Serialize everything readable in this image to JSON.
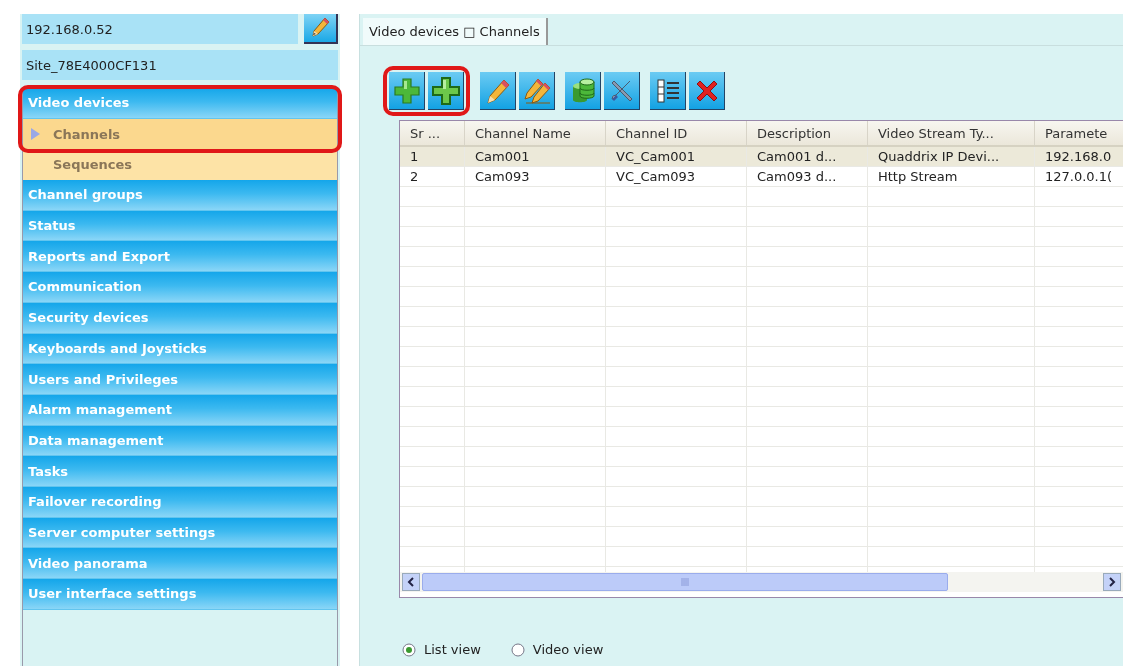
{
  "connection": {
    "address": "192.168.0.52",
    "site": "Site_78E4000CF131"
  },
  "nav": {
    "items": [
      {
        "label": "Video devices",
        "selected": false,
        "highlighted": true,
        "children": [
          {
            "label": "Channels",
            "selected": true,
            "highlighted": true
          },
          {
            "label": "Sequences",
            "selected": false,
            "highlighted": false
          }
        ]
      },
      {
        "label": "Channel groups",
        "selected": false,
        "highlighted": false
      },
      {
        "label": "Status",
        "selected": false,
        "highlighted": false
      },
      {
        "label": "Reports and Export",
        "selected": false,
        "highlighted": false
      },
      {
        "label": "Communication",
        "selected": false,
        "highlighted": false
      },
      {
        "label": "Security devices",
        "selected": false,
        "highlighted": false
      },
      {
        "label": "Keyboards and Joysticks",
        "selected": false,
        "highlighted": false
      },
      {
        "label": "Users and Privileges",
        "selected": false,
        "highlighted": false
      },
      {
        "label": "Alarm management",
        "selected": false,
        "highlighted": false
      },
      {
        "label": "Data management",
        "selected": false,
        "highlighted": false
      },
      {
        "label": "Tasks",
        "selected": false,
        "highlighted": false
      },
      {
        "label": "Failover recording",
        "selected": false,
        "highlighted": false
      },
      {
        "label": "Server computer settings",
        "selected": false,
        "highlighted": false
      },
      {
        "label": "Video panorama",
        "selected": false,
        "highlighted": false
      },
      {
        "label": "User interface settings",
        "selected": false,
        "highlighted": false
      }
    ]
  },
  "tabs": [
    {
      "label": "Video devices □ Channels",
      "selected": true
    }
  ],
  "toolbar": {
    "buttons": [
      {
        "kind": "add",
        "highlighted": true
      },
      {
        "kind": "add-multiple",
        "highlighted": true
      },
      {
        "kind": "edit",
        "highlighted": false
      },
      {
        "kind": "edit-multiple",
        "highlighted": false
      },
      {
        "kind": "database",
        "highlighted": false
      },
      {
        "kind": "tools",
        "highlighted": false
      },
      {
        "kind": "list",
        "highlighted": false
      },
      {
        "kind": "delete",
        "highlighted": false
      }
    ]
  },
  "table": {
    "columns": [
      "Sr ...",
      "Channel Name",
      "Channel ID",
      "Description",
      "Video Stream Ty...",
      "Paramete"
    ],
    "rows": [
      {
        "selected": true,
        "cells": [
          "1",
          "Cam001",
          "VC_Cam001",
          "Cam001 d...",
          "Quaddrix IP Devi...",
          "192.168.0"
        ]
      },
      {
        "selected": false,
        "cells": [
          "2",
          "Cam093",
          "VC_Cam093",
          "Cam093 d...",
          "Http Stream",
          "127.0.0.1("
        ]
      }
    ]
  },
  "view_options": [
    {
      "label": "List view",
      "selected": true
    },
    {
      "label": "Video view",
      "selected": false
    }
  ]
}
